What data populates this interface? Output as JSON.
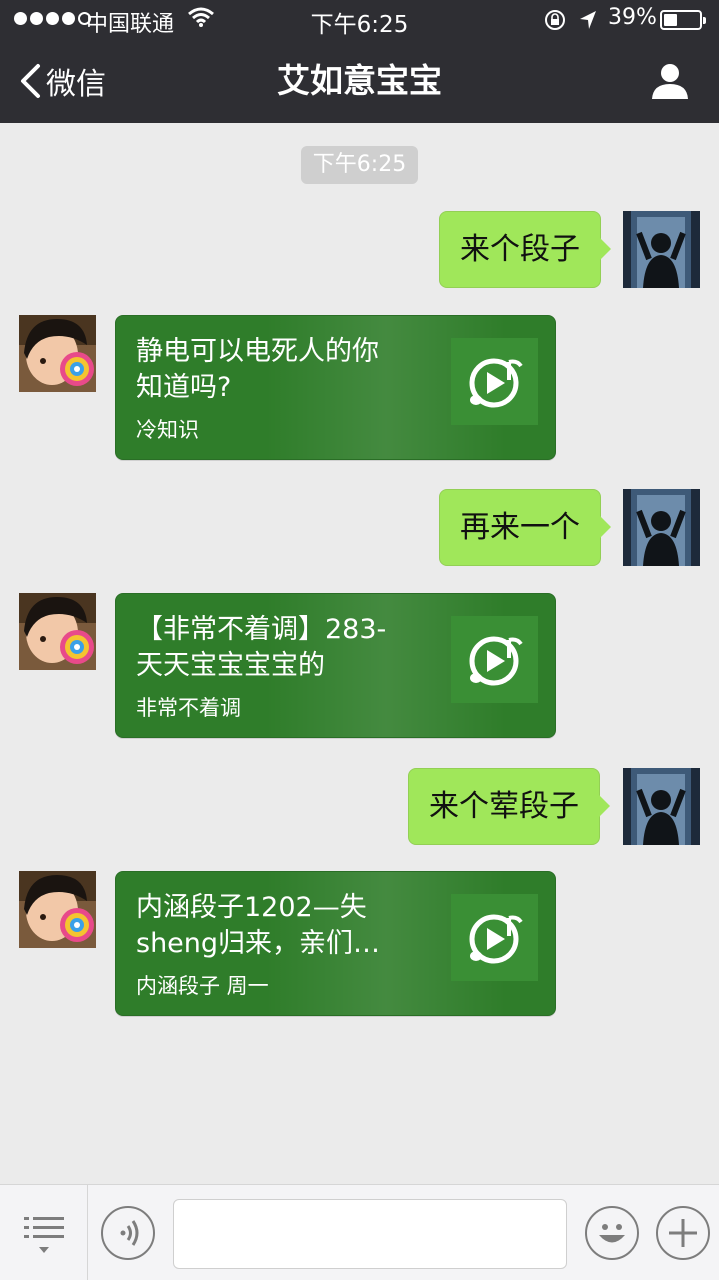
{
  "status_bar": {
    "carrier": "中国联通",
    "time": "下午6:25",
    "battery_pct": "39%",
    "battery_level": 0.39,
    "signal_bars": 4
  },
  "nav": {
    "back_label": "微信",
    "title": "艾如意宝宝"
  },
  "chat": {
    "timestamp": "下午6:25",
    "messages": [
      {
        "from": "me",
        "text": "来个段子"
      },
      {
        "from": "them",
        "title": "静电可以电死人的你\n知道吗?",
        "source": "冷知识"
      },
      {
        "from": "me",
        "text": "再来一个"
      },
      {
        "from": "them",
        "title": "【非常不着调】283-\n天天宝宝宝宝的",
        "source": "非常不着调"
      },
      {
        "from": "me",
        "text": "来个荤段子"
      },
      {
        "from": "them",
        "title": "内涵段子1202—失\nsheng归来，亲们…",
        "source": "内涵段子 周一"
      }
    ]
  },
  "colors": {
    "nav_bg": "#2e2e33",
    "chat_bg": "#ebebeb",
    "outgoing_bubble": "#a0e75a",
    "incoming_card": "#2f7d2a"
  },
  "icons": {
    "back": "chevron-left-icon",
    "profile": "person-icon",
    "menu": "list-menu-icon",
    "voice": "voice-icon",
    "emoji": "smiley-icon",
    "plus": "plus-icon",
    "music": "music-play-icon"
  }
}
